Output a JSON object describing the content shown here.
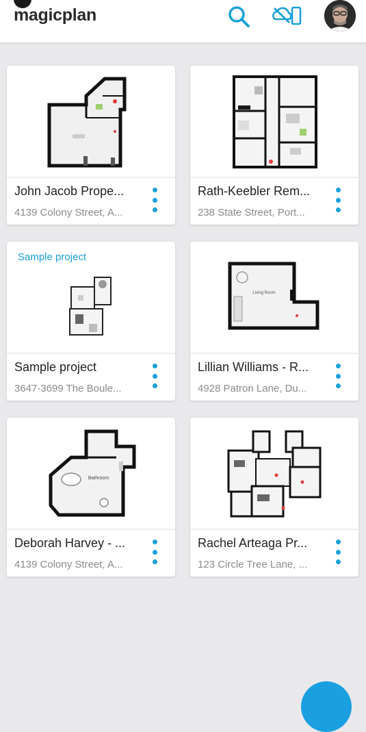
{
  "header": {
    "app_name": "magicplan",
    "search_icon": "search-icon",
    "sync_icon": "sync-off-icon",
    "profile_icon": "avatar"
  },
  "accent_color": "#1aa0d8",
  "projects": [
    {
      "name": "John Jacob Prope...",
      "address": "4139 Colony Street, A...",
      "badge": ""
    },
    {
      "name": "Rath-Keebler Rem...",
      "address": "238 State Street, Port...",
      "badge": ""
    },
    {
      "name": "Sample project",
      "address": "3647-3699 The Boule...",
      "badge": "Sample project"
    },
    {
      "name": "Lillian Williams - R...",
      "address": "4928 Patron Lane, Du...",
      "badge": ""
    },
    {
      "name": "Deborah Harvey - ...",
      "address": "4139 Colony Street, A...",
      "badge": ""
    },
    {
      "name": "Rachel Arteaga Pr...",
      "address": "123 Circle Tree Lane, ...",
      "badge": ""
    }
  ],
  "floorplan_labels": {
    "living_room": "Living Room",
    "bathroom": "Bathroom"
  },
  "fab_icon": "add-icon"
}
